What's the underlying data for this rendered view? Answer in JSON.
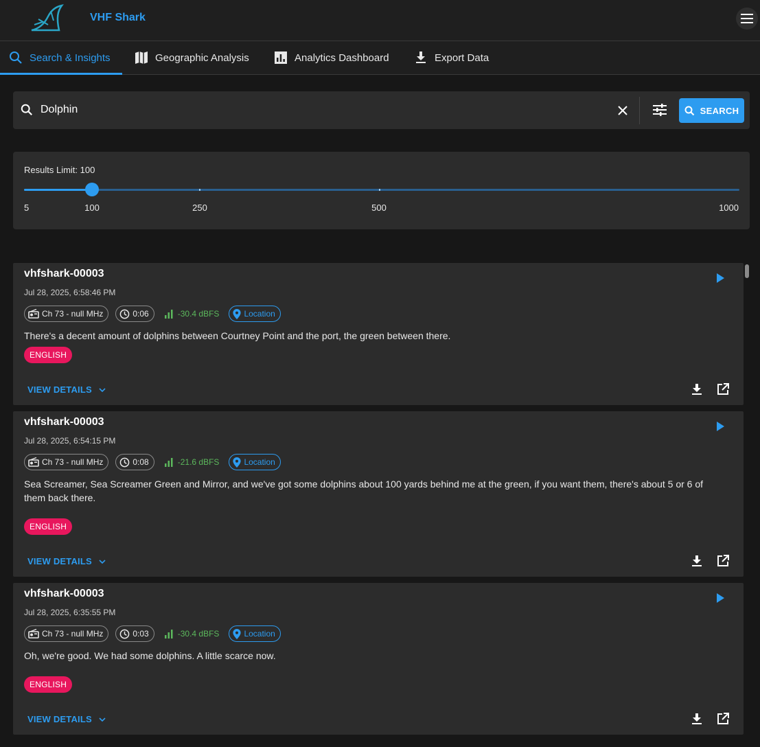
{
  "app": {
    "title": "VHF Shark"
  },
  "tabs": [
    {
      "label": "Search & Insights",
      "icon": "search-icon"
    },
    {
      "label": "Geographic Analysis",
      "icon": "map-icon"
    },
    {
      "label": "Analytics Dashboard",
      "icon": "analytics-icon"
    },
    {
      "label": "Export Data",
      "icon": "download-icon"
    }
  ],
  "search": {
    "value": "Dolphin",
    "button_label": "SEARCH"
  },
  "results_limit": {
    "label": "Results Limit: 100",
    "value": 100,
    "marks": [
      "5",
      "100",
      "250",
      "500",
      "1000"
    ]
  },
  "results": [
    {
      "title": "vhfshark-00003",
      "date": "Jul 28, 2025, 6:58:46 PM",
      "channel": "Ch 73 - null MHz",
      "duration": "0:06",
      "signal": "-30.4 dBFS",
      "location_label": "Location",
      "transcript": "There's a decent amount of dolphins between Courtney Point and the port, the green between there.",
      "language": "ENGLISH",
      "details_label": "VIEW DETAILS"
    },
    {
      "title": "vhfshark-00003",
      "date": "Jul 28, 2025, 6:54:15 PM",
      "channel": "Ch 73 - null MHz",
      "duration": "0:08",
      "signal": "-21.6 dBFS",
      "location_label": "Location",
      "transcript": "Sea Screamer, Sea Screamer Green and Mirror, and we've got some dolphins about 100 yards behind me at the green, if you want them, there's about 5 or 6 of them back there.",
      "language": "ENGLISH",
      "details_label": "VIEW DETAILS"
    },
    {
      "title": "vhfshark-00003",
      "date": "Jul 28, 2025, 6:35:55 PM",
      "channel": "Ch 73 - null MHz",
      "duration": "0:03",
      "signal": "-30.4 dBFS",
      "location_label": "Location",
      "transcript": "Oh, we're good. We had some dolphins. A little scarce now.",
      "language": "ENGLISH",
      "details_label": "VIEW DETAILS"
    }
  ],
  "colors": {
    "accent": "#2d9cf0",
    "signal": "#5cb85c",
    "language_badge": "#e8175d",
    "background": "#171717",
    "surface": "#2c2c2c"
  }
}
